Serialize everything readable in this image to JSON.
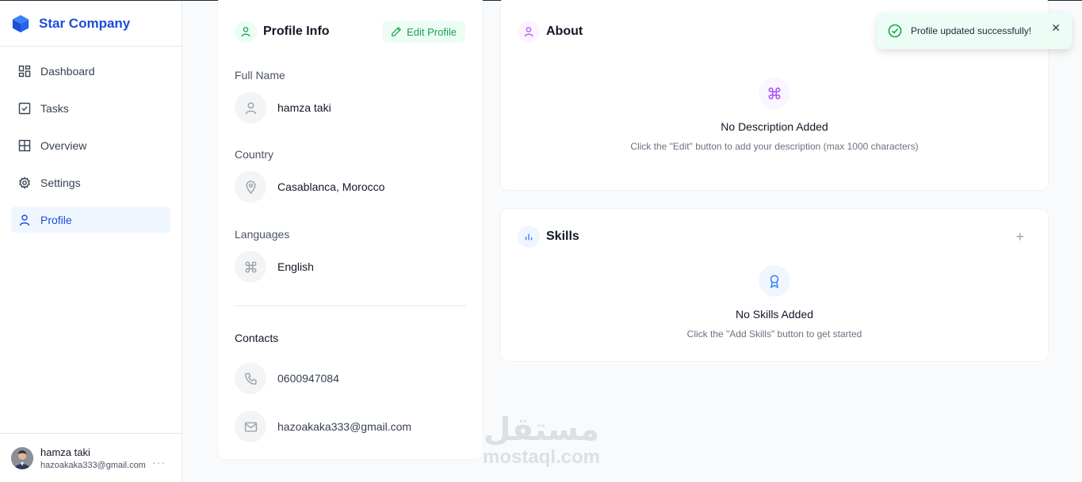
{
  "brand": {
    "name": "Star Company",
    "color": "#1d4ed8"
  },
  "sidebar": {
    "items": [
      {
        "label": "Dashboard",
        "icon": "dashboard-icon"
      },
      {
        "label": "Tasks",
        "icon": "checkbox-icon"
      },
      {
        "label": "Overview",
        "icon": "grid-icon"
      },
      {
        "label": "Settings",
        "icon": "gear-icon"
      },
      {
        "label": "Profile",
        "icon": "user-icon",
        "active": true
      }
    ]
  },
  "user": {
    "name": "hamza taki",
    "email": "hazoakaka333@gmail.com"
  },
  "profile_info": {
    "title": "Profile Info",
    "edit_label": "Edit Profile",
    "full_name_label": "Full Name",
    "full_name": "hamza taki",
    "country_label": "Country",
    "country": "Casablanca, Morocco",
    "languages_label": "Languages",
    "language": "English",
    "contacts_label": "Contacts",
    "phone": "0600947084",
    "email": "hazoakaka333@gmail.com"
  },
  "about": {
    "title": "About",
    "empty_title": "No Description Added",
    "empty_sub": "Click the \"Edit\" button to add your description (max 1000 characters)"
  },
  "skills": {
    "title": "Skills",
    "add_symbol": "+",
    "empty_title": "No Skills Added",
    "empty_sub": "Click the \"Add Skills\" button to get started"
  },
  "toast": {
    "message": "Profile updated successfully!",
    "close_symbol": "✕"
  },
  "watermark": {
    "arabic": "مستقل",
    "latin": "mostaql.com"
  },
  "colors": {
    "accent": "#1d4ed8",
    "success": "#16a34a",
    "about_accent": "#a855f7",
    "skills_accent": "#3b82f6"
  }
}
